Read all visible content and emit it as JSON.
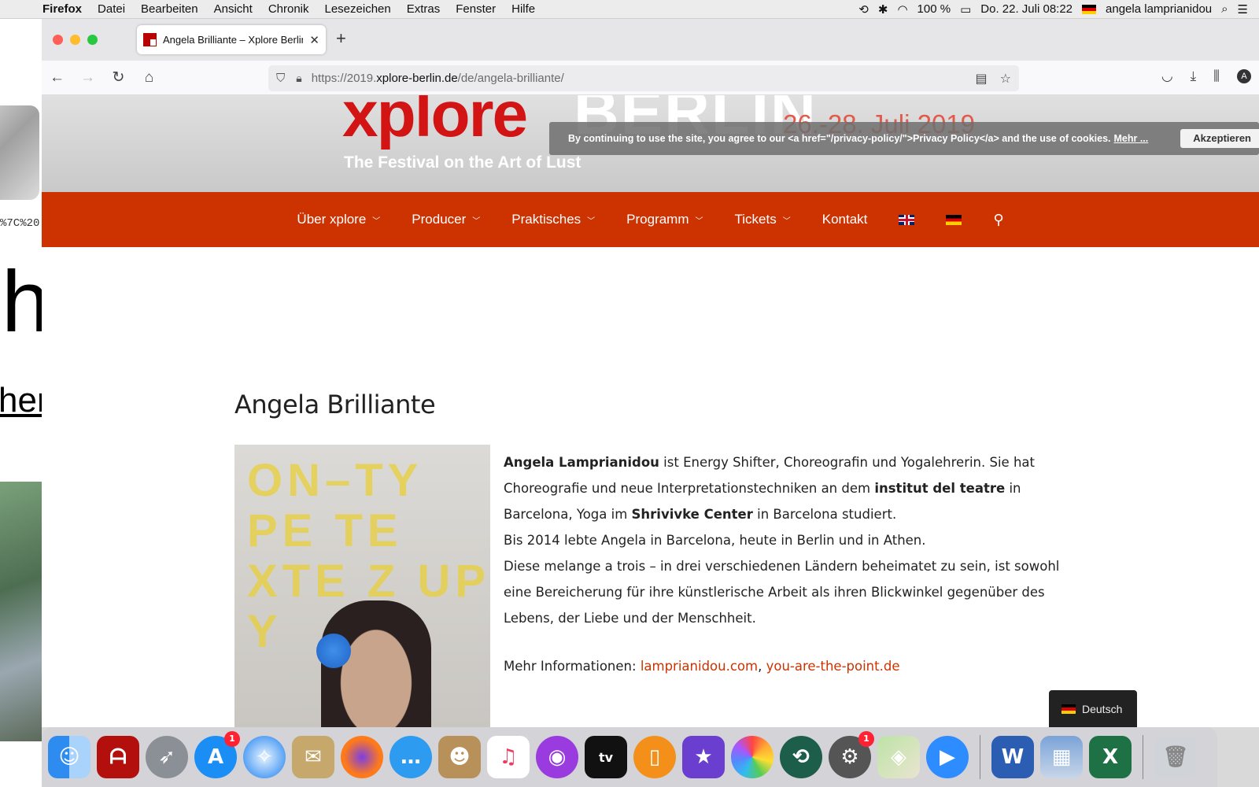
{
  "menubar": {
    "app": "Firefox",
    "items": [
      "Datei",
      "Bearbeiten",
      "Ansicht",
      "Chronik",
      "Lesezeichen",
      "Extras",
      "Fenster",
      "Hilfe"
    ],
    "battery": "100 %",
    "datetime": "Do. 22. Juli  08:22",
    "user": "angela lamprianidou"
  },
  "background_window": {
    "url_fragment": "%7C%20",
    "big_letter": "h",
    "big_link_fragment": "her"
  },
  "browser": {
    "tab_title": "Angela Brilliante – Xplore Berlin",
    "url_prefix": "https://2019.",
    "url_domain": "xplore-berlin.de",
    "url_path": "/de/angela-brilliante/"
  },
  "site": {
    "logo_word1": "xplore",
    "logo_word2": "BERLIN",
    "dates": "26.-28. Juli 2019",
    "tagline": "The Festival on the Art of Lust",
    "cookie_text": "By continuing to use the site, you agree to our <a href=\"/privacy-policy/\">Privacy Policy</a> and the use of cookies.",
    "cookie_more": "Mehr ...",
    "cookie_accept": "Akzeptieren",
    "nav": [
      "Über xplore",
      "Producer",
      "Praktisches",
      "Programm",
      "Tickets",
      "Kontakt"
    ],
    "page_title": "Angela Brilliante",
    "portrait_poster_text": "ON–TY PE TE XTE Z UP Y",
    "bio": {
      "name": "Angela Lamprianidou",
      "p1a": " ist Energy Shifter, Choreografin und Yogalehrerin. Sie hat Choreografie und neue Interpretationstechniken an dem ",
      "inst1": "institut del teatre",
      "p1b": " in Barcelona, Yoga im ",
      "inst2": "Shrivivke Center",
      "p1c": " in Barcelona studiert.",
      "p2": "Bis 2014 lebte Angela in Barcelona, heute in Berlin und in Athen.",
      "p3": "Diese melange a trois – in drei verschiedenen Ländern beheimatet zu sein, ist sowohl eine Bereicherung für ihre künstlerische Arbeit als ihren Blickwinkel gegenüber des Lebens, der Liebe und der Menschheit.",
      "more_label": "Mehr Informationen: ",
      "link1": "lamprianidou.com",
      "sep": ", ",
      "link2": "you-are-the-point.de"
    },
    "language_switch": "Deutsch"
  },
  "dock": {
    "items": [
      "finder-icon",
      "acrobat-icon",
      "launchpad-icon",
      "app-store-icon",
      "safari-icon",
      "mail-icon",
      "firefox-icon",
      "messages-icon",
      "contacts-icon",
      "music-icon",
      "podcasts-icon",
      "apple-tv-icon",
      "books-icon",
      "imovie-icon",
      "photos-icon",
      "time-machine-icon",
      "system-preferences-icon",
      "maps-icon",
      "zoom-icon",
      "word-icon",
      "preview-icon",
      "excel-icon",
      "trash-icon"
    ],
    "badges": {
      "app_store": "1",
      "system_preferences": "1"
    }
  },
  "colors": {
    "brand_red": "#cc3300",
    "link": "#cc3300"
  }
}
